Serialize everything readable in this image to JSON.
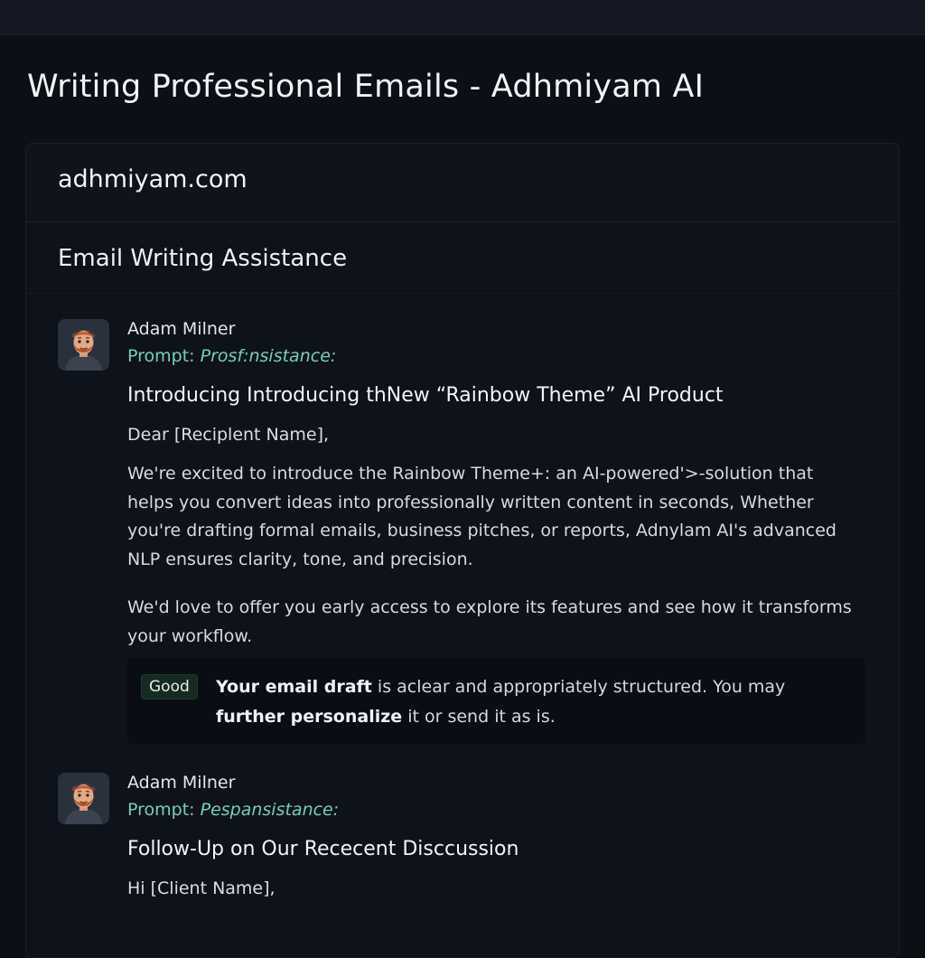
{
  "page": {
    "title": "Writing Professional Emails - Adhmiyam AI"
  },
  "panel": {
    "site_name": "adhmiyam.com",
    "section_title": "Email Writing Assistance"
  },
  "messages": [
    {
      "author": "Adam Milner",
      "prompt_label": "Prompt:",
      "prompt_value": "Prosf:nsistance:",
      "avatar_icon": "user-avatar-icon",
      "subject": "Introducing Introducing thNew “Rainbow Theme” AI Product",
      "greeting": "Dear [Reciplent Name],",
      "paragraphs": [
        "We're excited to introduce the Rainbow Theme+: an AI-powered'>-solution that helps you convert ideas into professionally written content in seconds, Whether you're drafting formal emails, business pitches, or reports, Adnylam AI's advanced NLP ensures clarity, tone, and precision.",
        "We'd love to offer you early access to explore its features and see how it transforms your workflow."
      ],
      "feedback": {
        "badge": "Good",
        "bold_1": "Your email draft",
        "text_1": " is aclear and appropriately  structured. You may",
        "bold_2": "further personalize",
        "text_2": " it or send it as is."
      }
    },
    {
      "author": "Adam Milner",
      "prompt_label": "Prompt:",
      "prompt_value": "Pespansistance:",
      "avatar_icon": "user-avatar-icon",
      "subject": "Follow-Up on Our Rececent Disccussion",
      "greeting": "Hi [Client Name],"
    }
  ],
  "colors": {
    "background": "#0b0f16",
    "panel": "#0e121a",
    "prompt_accent": "#6fd1b6",
    "badge_bg": "#142a22"
  }
}
